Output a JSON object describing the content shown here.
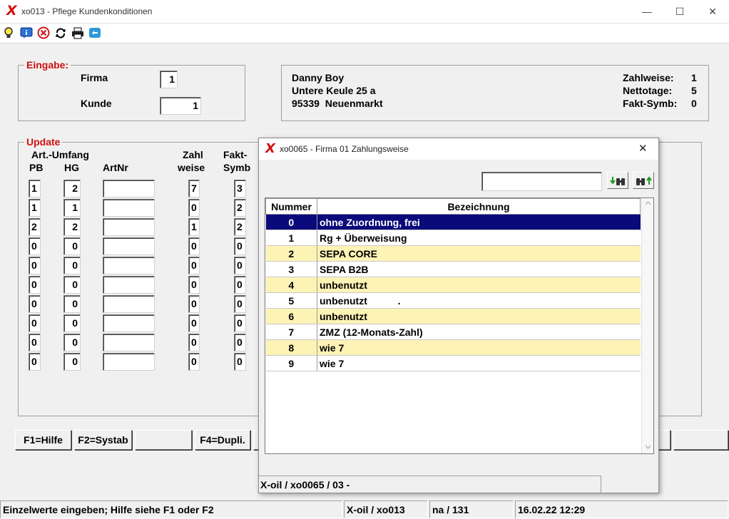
{
  "window": {
    "title": "xo013 - Pflege Kundenkonditionen",
    "logo": "X",
    "minimize": "—",
    "maximize": "☐",
    "close": "✕"
  },
  "toolbar": {
    "icons": [
      "lightbulb-icon",
      "info-icon",
      "cancel-icon",
      "refresh-icon",
      "print-icon",
      "chat-icon"
    ]
  },
  "eingabe": {
    "legend": "Eingabe:",
    "firma_label": "Firma",
    "firma_value": "1",
    "kunde_label": "Kunde",
    "kunde_value": "1"
  },
  "customer": {
    "name": "Danny Boy",
    "street": "Untere Keule 25 a",
    "city": "95339  Neuenmarkt",
    "zahlweise_label": "Zahlweise:",
    "zahlweise_value": "1",
    "nettotage_label": "Nettotage:",
    "nettotage_value": "5",
    "faktsymb_label": "Fakt-Symb:",
    "faktsymb_value": "0"
  },
  "update": {
    "legend": "Update",
    "header_artumfang": "Art.-Umfang",
    "header_pb": "PB",
    "header_hg": "HG",
    "header_artnr": "ArtNr",
    "header_zahl": "Zahl",
    "header_weise": "weise",
    "header_fakt": "Fakt-",
    "header_symb": "Symb",
    "rows": [
      {
        "pb": "1",
        "hg": "2",
        "artnr": "",
        "zahlweise": "7",
        "faktsymb": "3"
      },
      {
        "pb": "1",
        "hg": "1",
        "artnr": "",
        "zahlweise": "0",
        "faktsymb": "2"
      },
      {
        "pb": "2",
        "hg": "2",
        "artnr": "",
        "zahlweise": "1",
        "faktsymb": "2"
      },
      {
        "pb": "0",
        "hg": "0",
        "artnr": "",
        "zahlweise": "0",
        "faktsymb": "0"
      },
      {
        "pb": "0",
        "hg": "0",
        "artnr": "",
        "zahlweise": "0",
        "faktsymb": "0"
      },
      {
        "pb": "0",
        "hg": "0",
        "artnr": "",
        "zahlweise": "0",
        "faktsymb": "0"
      },
      {
        "pb": "0",
        "hg": "0",
        "artnr": "",
        "zahlweise": "0",
        "faktsymb": "0"
      },
      {
        "pb": "0",
        "hg": "0",
        "artnr": "",
        "zahlweise": "0",
        "faktsymb": "0"
      },
      {
        "pb": "0",
        "hg": "0",
        "artnr": "",
        "zahlweise": "0",
        "faktsymb": "0"
      },
      {
        "pb": "0",
        "hg": "0",
        "artnr": "",
        "zahlweise": "0",
        "faktsymb": "0"
      }
    ]
  },
  "fkeys": {
    "f1": "F1=Hilfe",
    "f2": "F2=Systab",
    "f3": "",
    "f4": "F4=Dupli."
  },
  "statusbar": {
    "hint": "Einzelwerte eingeben; Hilfe siehe F1 oder F2",
    "program": "X-oil / xo013",
    "user": "na / 131",
    "datetime": "16.02.22 12:29"
  },
  "dialog": {
    "title": "xo0065 - Firma 01 Zahlungsweise",
    "close": "✕",
    "search_value": "",
    "header_nummer": "Nummer",
    "header_bezeichnung": "Bezeichnung",
    "rows": [
      {
        "nummer": "0",
        "bezeichnung": "ohne Zuordnung, frei"
      },
      {
        "nummer": "1",
        "bezeichnung": "Rg + Überweisung"
      },
      {
        "nummer": "2",
        "bezeichnung": "SEPA CORE"
      },
      {
        "nummer": "3",
        "bezeichnung": "SEPA B2B"
      },
      {
        "nummer": "4",
        "bezeichnung": "unbenutzt"
      },
      {
        "nummer": "5",
        "bezeichnung": "unbenutzt           ."
      },
      {
        "nummer": "6",
        "bezeichnung": "unbenutzt"
      },
      {
        "nummer": "7",
        "bezeichnung": "ZMZ (12-Monats-Zahl)"
      },
      {
        "nummer": "8",
        "bezeichnung": "wie 7"
      },
      {
        "nummer": "9",
        "bezeichnung": "wie 7"
      }
    ],
    "status": "X-oil / xo0065 / 03 -"
  }
}
